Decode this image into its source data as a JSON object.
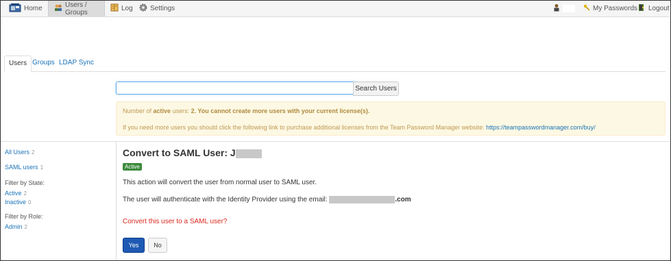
{
  "nav": {
    "home": "Home",
    "users_groups": "Users / Groups",
    "log": "Log",
    "settings": "Settings",
    "my_passwords": "My Passwords",
    "logout": "Logout"
  },
  "tabs": [
    "Users",
    "Groups",
    "LDAP Sync"
  ],
  "search": {
    "value": "",
    "button": "Search Users"
  },
  "alert": {
    "line1_prefix": "Number of ",
    "line1_active": "active",
    "line1_mid": " users: ",
    "line1_count": "2",
    "line1_warning": ". You cannot create more users with your current license(s).",
    "line2_text": "If you need more users you should click the following link to purchase additional licenses from the Team Password Manager website: ",
    "line2_link": "https://teampasswordmanager.com/buy/"
  },
  "sidebar": {
    "all_users": "All Users",
    "all_users_count": "2",
    "saml_users": "SAML users",
    "saml_users_count": "1",
    "filter_state": "Filter by State:",
    "active": "Active",
    "active_count": "2",
    "inactive": "Inactive",
    "inactive_count": "0",
    "filter_role": "Filter by Role:",
    "admin": "Admin",
    "admin_count": "2"
  },
  "main": {
    "title": "Convert to SAML User:",
    "title_initial": "J",
    "status_badge": "Active",
    "description": "This action will convert the user from normal user to SAML user.",
    "email_text": "The user will authenticate with the Identity Provider using the email:",
    "email_suffix": ".com",
    "question": "Convert this user to a SAML user?",
    "yes": "Yes",
    "no": "No"
  },
  "colors": {
    "link": "#1a73b8",
    "alert_bg": "#fcf8e3",
    "alert_text": "#c09853",
    "badge": "#3c8a3c",
    "question": "#d9281e",
    "primary_button": "#1e5ab4"
  }
}
